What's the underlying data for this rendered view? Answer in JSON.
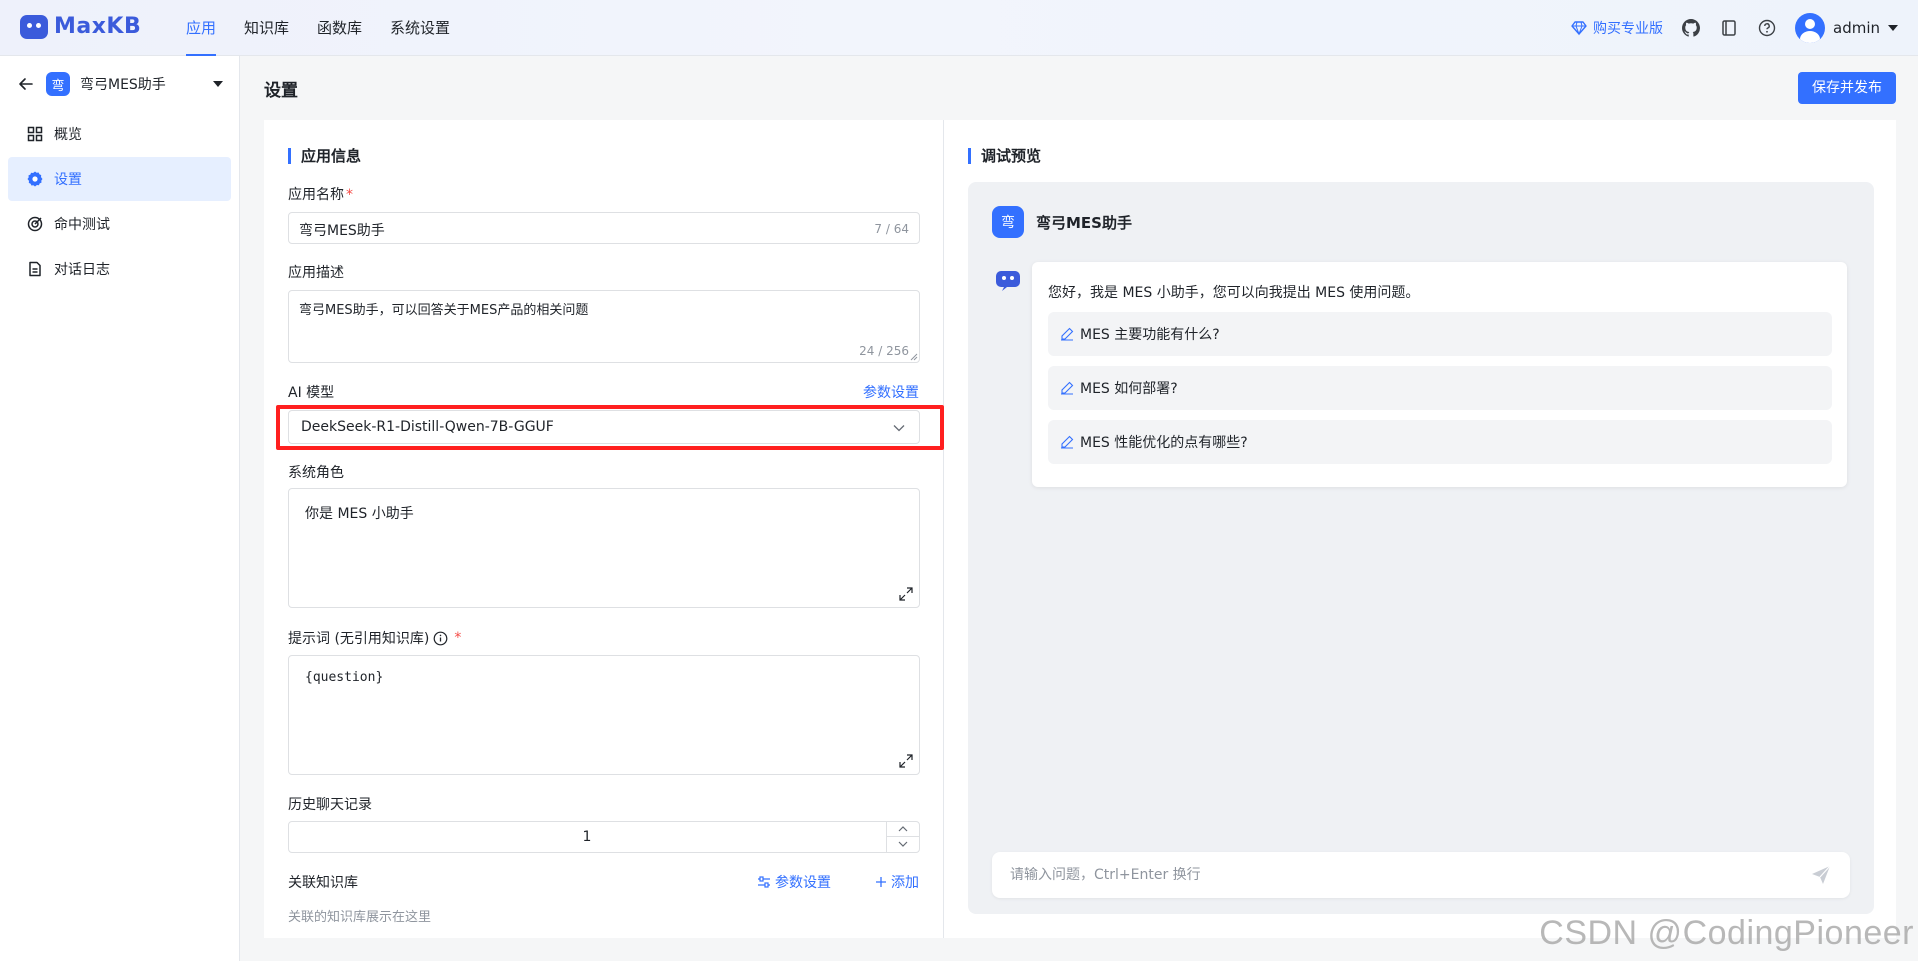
{
  "brand": {
    "name": "MaxKB",
    "accent": "#3370ff"
  },
  "topnav": [
    {
      "label": "应用",
      "active": true
    },
    {
      "label": "知识库",
      "active": false
    },
    {
      "label": "函数库",
      "active": false
    },
    {
      "label": "系统设置",
      "active": false
    }
  ],
  "topright": {
    "buy_label": "购买专业版",
    "icons": [
      "github-icon",
      "book-icon",
      "help-icon"
    ],
    "user_name": "admin"
  },
  "sidebar": {
    "app_badge": "弯",
    "app_name": "弯弓MES助手",
    "items": [
      {
        "label": "概览",
        "icon": "grid-icon",
        "active": false
      },
      {
        "label": "设置",
        "icon": "gear-icon",
        "active": true
      },
      {
        "label": "命中测试",
        "icon": "target-icon",
        "active": false
      },
      {
        "label": "对话日志",
        "icon": "document-icon",
        "active": false
      }
    ]
  },
  "page": {
    "title": "设置",
    "publish_label": "保存并发布"
  },
  "form": {
    "section_title": "应用信息",
    "name_label": "应用名称",
    "name_value": "弯弓MES助手",
    "name_counter": "7 / 64",
    "desc_label": "应用描述",
    "desc_value": "弯弓MES助手，可以回答关于MES产品的相关问题",
    "desc_counter": "24 / 256",
    "model_label": "AI 模型",
    "model_param_link": "参数设置",
    "model_value": "DeekSeek-R1-Distill-Qwen-7B-GGUF",
    "role_label": "系统角色",
    "role_value": "你是 MES 小助手",
    "prompt_label": "提示词 (无引用知识库)",
    "prompt_value": "{question}",
    "history_label": "历史聊天记录",
    "history_value": "1",
    "kb_label": "关联知识库",
    "kb_param_link": "参数设置",
    "kb_add_link": "添加",
    "kb_placeholder": "关联的知识库展示在这里"
  },
  "preview": {
    "section_title": "调试预览",
    "badge": "弯",
    "app_name": "弯弓MES助手",
    "greeting": "您好，我是 MES 小助手，您可以向我提出 MES 使用问题。",
    "questions": [
      "MES 主要功能有什么?",
      "MES 如何部署?",
      "MES 性能优化的点有哪些?"
    ],
    "input_placeholder": "请输入问题，Ctrl+Enter 换行"
  },
  "watermark": "CSDN @CodingPioneer"
}
